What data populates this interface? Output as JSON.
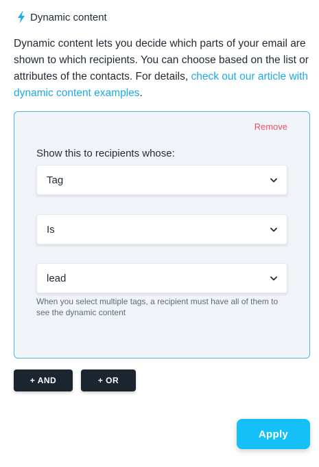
{
  "header": {
    "icon": "lightning-bolt-icon",
    "title": "Dynamic content"
  },
  "intro": {
    "text": "Dynamic content lets you decide which parts of your email are shown to which recipients. You can choose based on the list or attributes of the contacts. For details, ",
    "link": "check out our article with dynamic content examples",
    "suffix": "."
  },
  "condition": {
    "remove_label": "Remove",
    "show_label": "Show this to recipients whose:",
    "field_select": {
      "value": "Tag"
    },
    "operator_select": {
      "value": "Is"
    },
    "value_select": {
      "value": "lead"
    },
    "hint": "When you select multiple tags, a recipient must have all of them to see the dynamic content"
  },
  "actions": {
    "and_label": "+ AND",
    "or_label": "+ OR",
    "apply_label": "Apply"
  },
  "colors": {
    "accent": "#15c0f8",
    "link": "#1da9e6",
    "remove": "#e8525c",
    "dark_button": "#1c252f",
    "panel_bg": "#f1f5f9",
    "panel_border": "#4fb3e8"
  }
}
